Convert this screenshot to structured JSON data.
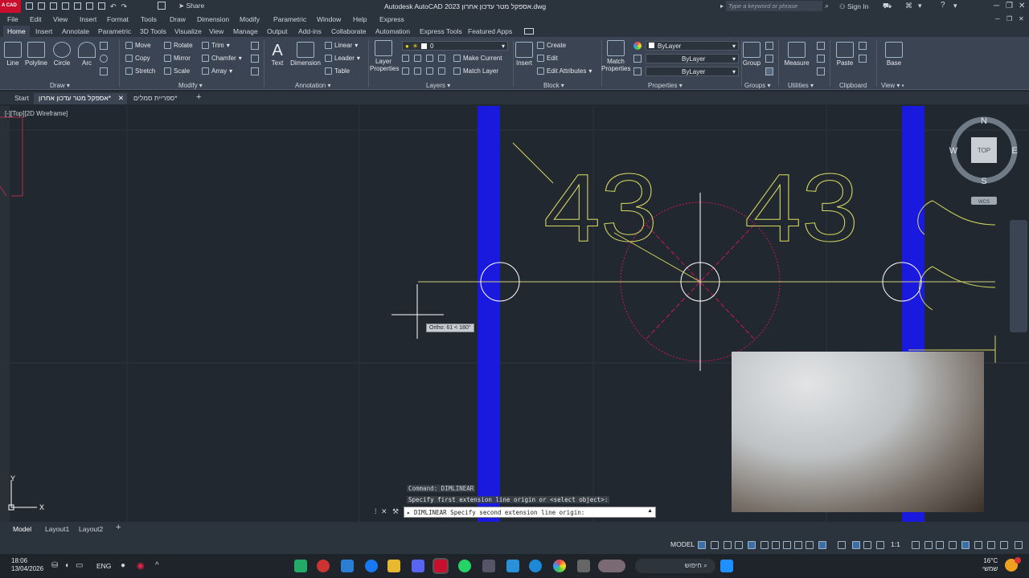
{
  "title": {
    "app_badge": "A CAD",
    "share": "Share",
    "window_title": "Autodesk AutoCAD 2023  אספקל מטר עדכון אחרון.dwg",
    "search_placeholder": "Type a keyword or phrase",
    "sign_in": "Sign In"
  },
  "menu": [
    "File",
    "Edit",
    "View",
    "Insert",
    "Format",
    "Tools",
    "Draw",
    "Dimension",
    "Modify",
    "Parametric",
    "Window",
    "Help",
    "Express"
  ],
  "ribbon_tabs": [
    "Home",
    "Insert",
    "Annotate",
    "Parametric",
    "3D Tools",
    "Visualize",
    "View",
    "Manage",
    "Output",
    "Add-ins",
    "Collaborate",
    "Automation",
    "Express Tools",
    "Featured Apps"
  ],
  "ribbon": {
    "draw": {
      "label": "Draw",
      "line": "Line",
      "polyline": "Polyline",
      "circle": "Circle",
      "arc": "Arc"
    },
    "modify": {
      "label": "Modify",
      "move": "Move",
      "rotate": "Rotate",
      "trim": "Trim",
      "copy": "Copy",
      "mirror": "Mirror",
      "chamfer": "Chamfer",
      "stretch": "Stretch",
      "scale": "Scale",
      "array": "Array"
    },
    "annotation": {
      "label": "Annotation",
      "text": "Text",
      "dimension": "Dimension",
      "linear": "Linear",
      "leader": "Leader",
      "table": "Table"
    },
    "layers": {
      "label": "Layers",
      "layer_properties": "Layer Properties",
      "make_current": "Make Current",
      "match_layer": "Match Layer",
      "current_layer": "0"
    },
    "block": {
      "label": "Block",
      "insert": "Insert",
      "create": "Create",
      "edit": "Edit",
      "edit_attributes": "Edit Attributes"
    },
    "properties": {
      "label": "Properties",
      "match_properties": "Match Properties",
      "bylayer1": "ByLayer",
      "bylayer2": "ByLayer",
      "bylayer3": "ByLayer"
    },
    "groups": {
      "label": "Groups",
      "group": "Group"
    },
    "utilities": {
      "label": "Utilities",
      "measure": "Measure"
    },
    "clipboard": {
      "label": "Clipboard",
      "paste": "Paste"
    },
    "view": {
      "label": "View",
      "base": "Base"
    }
  },
  "doc_tabs": {
    "start": "Start",
    "active": "אספקל מטר עדכון אחרון*",
    "second": "ספריית סמלים*"
  },
  "viewport": {
    "label": "[-][Top][2D Wireframe]",
    "dim_text_1": "43",
    "dim_text_2": "43",
    "ortho_tooltip": "Ortho: 61 < 180°",
    "viewcube": {
      "n": "N",
      "s": "S",
      "e": "E",
      "w": "W",
      "top": "TOP",
      "wcs": "WCS"
    },
    "ucs_y": "Y",
    "ucs_x": "X"
  },
  "command": {
    "history1": "Command:  DIMLINEAR",
    "history2": "Specify first extension line origin or <select object>:",
    "input": "DIMLINEAR Specify second extension line origin:"
  },
  "layout_tabs": [
    "Model",
    "Layout1",
    "Layout2"
  ],
  "status": {
    "model": "MODEL",
    "scale": "1:1"
  },
  "taskbar": {
    "time": "18:06",
    "date": "13/04/2026",
    "lang": "ENG",
    "temp": "16°C",
    "search": "חיפוש",
    "weather_note": "שמשי"
  }
}
